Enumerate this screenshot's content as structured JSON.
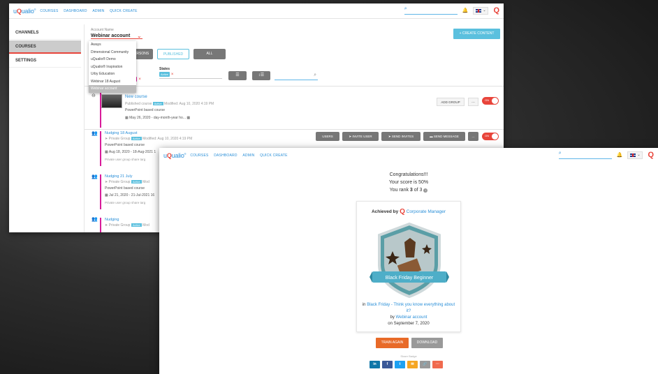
{
  "app": {
    "logo": "uQualio",
    "logo_mark": "®",
    "nav": [
      "COURSES",
      "DASHBOARD",
      "ADMIN",
      "QUICK CREATE"
    ],
    "search_placeholder": ""
  },
  "back": {
    "sidebar": [
      "CHANNELS",
      "COURSES",
      "SETTINGS"
    ],
    "account_label": "Account Name",
    "account_value": "Webinar account",
    "dropdown_options": [
      "Aways",
      "Dimensional Community",
      "uQualio® Demo",
      "uQualio® Inspiration",
      "Urby Education",
      "Webinar 18 August",
      "Webinar account"
    ],
    "create_content": "+ CREATE CONTENT",
    "tabs": [
      "PERSONS",
      "PUBLISHED",
      "ALL"
    ],
    "states_label": "States",
    "state_pill": "Active",
    "course": {
      "title": "New course",
      "meta_prefix": "Published course",
      "status": "Active",
      "modified": "Modified: Aug 10, 2020 4:19 PM",
      "desc": "PowerPoint based course",
      "date": "May 26, 2020 -   day-month-year ho...",
      "add_group": "ADD GROUP",
      "toggle": "ON"
    },
    "groups": [
      {
        "title": "Nudging 18 August",
        "meta": "Private   Group",
        "status": "Active",
        "modified": "Modified: Aug 10, 2020 4:19 PM",
        "desc": "PowerPoint based course",
        "date": "Aug 18, 2020 -   18-Aug-2021 1",
        "share": "Private user group   share targ"
      },
      {
        "title": "Nudging 21 July",
        "meta": "Private   Group",
        "status": "Active",
        "modified": "Mod",
        "desc": "PowerPoint based course",
        "date": "Jul 21, 2020 -   21-Jul-2021 16",
        "share": "Private user group   share targ"
      },
      {
        "title": "Nudging",
        "meta": "Private   Group",
        "status": "Active",
        "modified": "Mod",
        "desc": "",
        "date": "",
        "share": ""
      }
    ],
    "group_buttons": [
      "USERS",
      "INVITE USER",
      "SEND INVITES",
      "SEND MESSAGE"
    ]
  },
  "front": {
    "congrats": "Congratulations!!!",
    "score": "Your score is 50%",
    "rank_prefix": "You rank ",
    "rank_value": "3",
    "rank_suffix": " of 3",
    "achieved_by": "Achieved by",
    "corp": "Corporate Manager",
    "badge_name": "Black Friday Beginner",
    "in_word": "in",
    "course_link": "Black Friday - Think you know everything about it?",
    "by_word": "by",
    "account_link": "Webinar account",
    "date_line": "on September 7, 2020",
    "train_again": "TRAIN AGAIN",
    "download": "DOWNLOAD",
    "share_badge": "Share Badge",
    "socials": [
      {
        "label": "in",
        "color": "#0e76a8"
      },
      {
        "label": "f",
        "color": "#3b5998"
      },
      {
        "label": "t",
        "color": "#1da1f2"
      },
      {
        "label": "✉",
        "color": "#f5a623"
      },
      {
        "label": "🔗",
        "color": "#999999"
      },
      {
        "label": "···",
        "color": "#f06a4e"
      }
    ]
  },
  "colors": {
    "accent": "#2a8fd8",
    "brand_red": "#e8443a",
    "info": "#5bc0de",
    "magenta": "#d81b9a"
  }
}
